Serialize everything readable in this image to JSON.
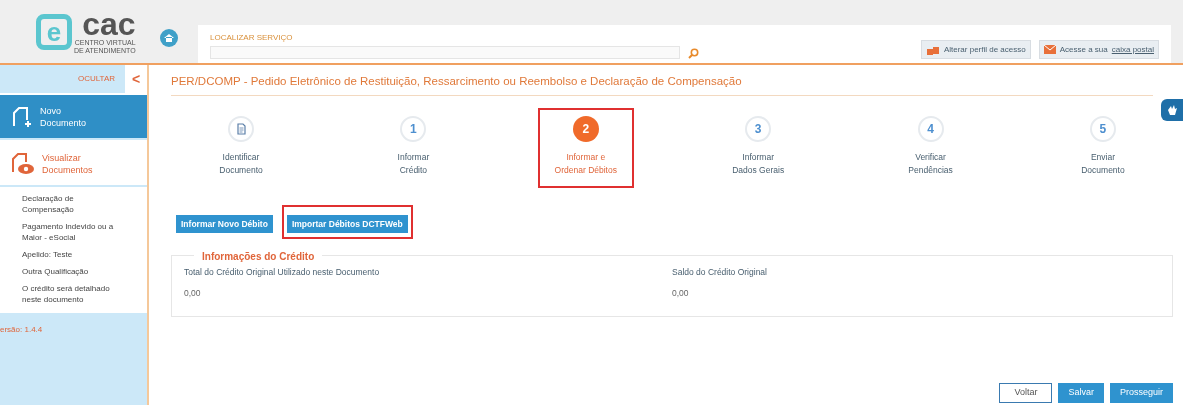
{
  "header": {
    "logo_letter": "e",
    "logo_word": "cac",
    "logo_subtitle_1": "CENTRO VIRTUAL",
    "logo_subtitle_2": "DE ATENDIMENTO",
    "search_label": "LOCALIZAR SERVIÇO",
    "profile_button": "Alterar perfil de acesso",
    "mailbox_text": "Acesse a sua",
    "mailbox_link": "caixa postal"
  },
  "sidebar": {
    "hide_label": "OCULTAR",
    "collapse_glyph": "<",
    "actions": [
      {
        "kind": "new",
        "label_1": "Novo",
        "label_2": "Documento",
        "selected": true
      },
      {
        "kind": "view",
        "label_1": "Visualizar",
        "label_2": "Documentos",
        "selected": false
      }
    ],
    "details": [
      "Declaração de Compensação",
      "Pagamento Indevido ou a Maior - eSocial",
      "Apelido: Teste",
      "Outra Qualificação",
      "O crédito será detalhado neste documento"
    ],
    "version": "ersão: 1.4.4"
  },
  "title": "PER/DCOMP - Pedido Eletrônico de Restituição, Ressarcimento ou Reembolso e Declaração de Compensação",
  "steps": [
    {
      "kind": "icon",
      "label_1": "Identificar",
      "label_2": "Documento",
      "selected": false,
      "highlighted": false
    },
    {
      "kind": "number",
      "number": "1",
      "label_1": "Informar",
      "label_2": "Crédito",
      "selected": false,
      "highlighted": false
    },
    {
      "kind": "number",
      "number": "2",
      "label_1": "Informar e",
      "label_2": "Ordenar Débitos",
      "selected": true,
      "highlighted": true
    },
    {
      "kind": "number",
      "number": "3",
      "label_1": "Informar",
      "label_2": "Dados Gerais",
      "selected": false,
      "highlighted": false
    },
    {
      "kind": "number",
      "number": "4",
      "label_1": "Verificar",
      "label_2": "Pendências",
      "selected": false,
      "highlighted": false
    },
    {
      "kind": "number",
      "number": "5",
      "label_1": "Enviar",
      "label_2": "Documento",
      "selected": false,
      "highlighted": false
    }
  ],
  "action_buttons": [
    {
      "label": "Informar Novo Débito",
      "highlighted": false
    },
    {
      "label": "Importar Débitos DCTFWeb",
      "highlighted": true
    }
  ],
  "credit_info": {
    "legend": "Informações do Crédito",
    "fields": [
      {
        "label": "Total do Crédito Original Utilizado neste Documento",
        "value": "0,00"
      },
      {
        "label": "Saldo do Crédito Original",
        "value": "0,00"
      }
    ]
  },
  "footer_buttons": [
    {
      "kind": "outline",
      "label": "Voltar"
    },
    {
      "kind": "primary",
      "label": "Salvar"
    },
    {
      "kind": "primary",
      "label": "Prosseguir"
    }
  ]
}
